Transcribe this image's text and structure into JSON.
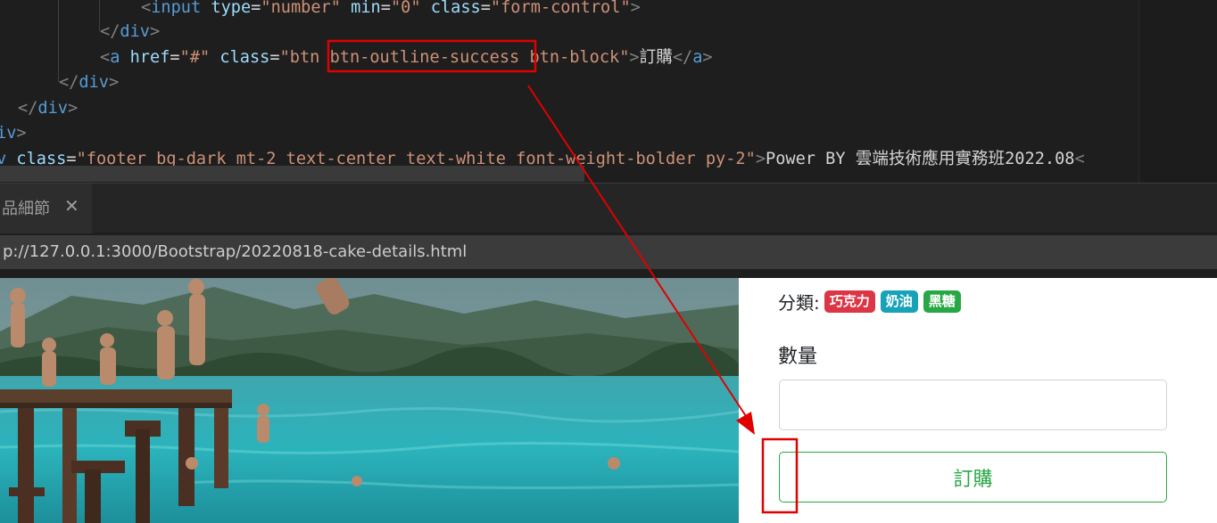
{
  "editor": {
    "lines": [
      {
        "tokens": [
          [
            "bracket",
            "<"
          ],
          [
            "tag",
            "input"
          ],
          [
            "text",
            " "
          ],
          [
            "attr",
            "type"
          ],
          [
            "text",
            "="
          ],
          [
            "str",
            "\"number\""
          ],
          [
            "text",
            " "
          ],
          [
            "attr",
            "min"
          ],
          [
            "text",
            "="
          ],
          [
            "str",
            "\"0\""
          ],
          [
            "text",
            " "
          ],
          [
            "attr",
            "class"
          ],
          [
            "text",
            "="
          ],
          [
            "str",
            "\"form-control\""
          ],
          [
            "bracket",
            ">"
          ]
        ]
      },
      {
        "tokens": [
          [
            "bracket",
            "</"
          ],
          [
            "tag",
            "div"
          ],
          [
            "bracket",
            ">"
          ]
        ]
      },
      {
        "tokens": [
          [
            "bracket",
            "<"
          ],
          [
            "tag",
            "a"
          ],
          [
            "text",
            " "
          ],
          [
            "attr",
            "href"
          ],
          [
            "text",
            "="
          ],
          [
            "str",
            "\"#\""
          ],
          [
            "text",
            " "
          ],
          [
            "attr",
            "class"
          ],
          [
            "text",
            "="
          ],
          [
            "str",
            "\"btn "
          ],
          [
            "str",
            "btn-outline-success"
          ],
          [
            "str",
            " btn-block\""
          ],
          [
            "bracket",
            ">"
          ],
          [
            "text",
            "訂購"
          ],
          [
            "bracket",
            "</"
          ],
          [
            "tag",
            "a"
          ],
          [
            "bracket",
            ">"
          ]
        ]
      },
      {
        "tokens": [
          [
            "bracket",
            "</"
          ],
          [
            "tag",
            "div"
          ],
          [
            "bracket",
            ">"
          ]
        ]
      },
      {
        "tokens": [
          [
            "bracket",
            "</"
          ],
          [
            "tag",
            "div"
          ],
          [
            "bracket",
            ">"
          ]
        ]
      },
      {
        "tokens": [
          [
            "tag",
            "iv"
          ],
          [
            "bracket",
            ">"
          ]
        ]
      },
      {
        "tokens": [
          [
            "tag",
            "v"
          ],
          [
            "text",
            " "
          ],
          [
            "attr",
            "class"
          ],
          [
            "text",
            "="
          ],
          [
            "str",
            "\"footer bg-dark mt-2 text-center text-white font-weight-bolder py-2\""
          ],
          [
            "bracket",
            ">"
          ],
          [
            "text",
            "Power BY 雲端技術應用實務班2022.08"
          ],
          [
            "bracket",
            "<"
          ]
        ]
      }
    ]
  },
  "preview_tab": {
    "title": "品細節",
    "close_label": "✕"
  },
  "url_bar": {
    "url": "p://127.0.0.1:3000/Bootstrap/20220818-cake-details.html"
  },
  "product": {
    "category_label": "分類:",
    "badges": [
      {
        "label": "巧克力",
        "color": "#dc3545"
      },
      {
        "label": "奶油",
        "color": "#17a2b8"
      },
      {
        "label": "黑糖",
        "color": "#28a745"
      }
    ],
    "quantity_label": "數量",
    "quantity_value": "",
    "order_button_label": "訂購"
  },
  "colors": {
    "annotation_red": "#e00000",
    "success_green": "#28a745"
  }
}
